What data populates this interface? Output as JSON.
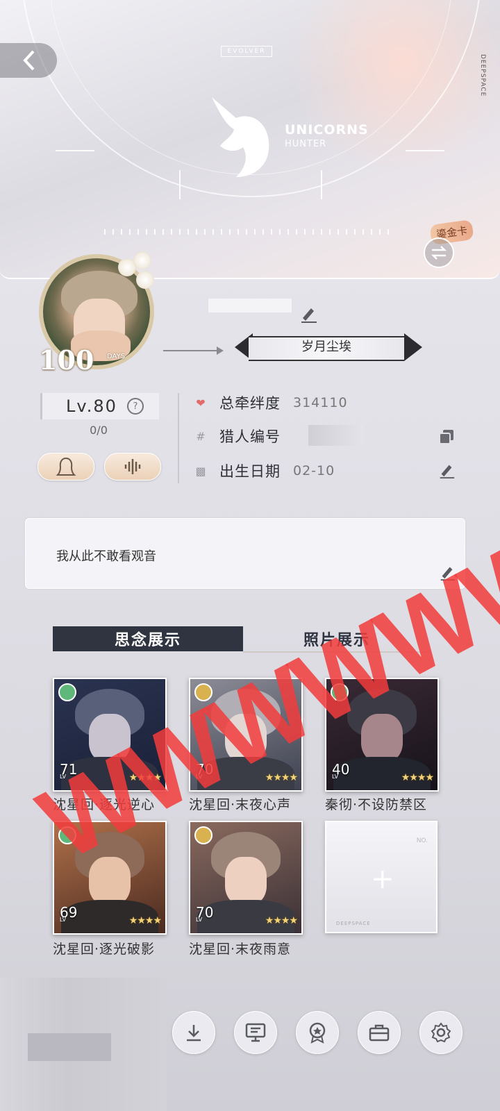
{
  "banner": {
    "evolver_label": "EVOLVER",
    "deepspace_label": "DEEPSPACE",
    "logo_line1": "UNICORNS",
    "logo_line2": "HUNTER",
    "card_badge": "鎏金卡"
  },
  "avatar": {
    "days_number": "100",
    "days_label": "DAYS"
  },
  "title_badge": "岁月尘埃",
  "level": {
    "label": "Lv.80",
    "help": "?",
    "exp": "0/0"
  },
  "info": {
    "bond_label": "总牵绊度",
    "bond_value": "314110",
    "hunter_id_label": "猎人编号",
    "birthday_label": "出生日期",
    "birthday_value": "02-10"
  },
  "signature": "我从此不敢看观音",
  "tabs": {
    "memory": "思念展示",
    "photo": "照片展示"
  },
  "memories": [
    {
      "name": "沈星回·逐光逆心",
      "level": "71",
      "badge_color": "#5fb87a"
    },
    {
      "name": "沈星回·末夜心声",
      "level": "70",
      "badge_color": "#d9b24f"
    },
    {
      "name": "秦彻·不设防禁区",
      "level": "40",
      "badge_color": "#5fb87a"
    },
    {
      "name": "沈星回·逐光破影",
      "level": "69",
      "badge_color": "#5fb87a"
    },
    {
      "name": "沈星回·末夜雨意",
      "level": "70",
      "badge_color": "#d9b24f"
    }
  ],
  "memory_lv_tag": "LV",
  "memory_stars": "★★★★",
  "add_slot": {
    "plus": "+",
    "no_label": "NO.",
    "brand": "DEEPSPACE"
  },
  "watermark": "WWWWWW",
  "dock": [
    "download-icon",
    "notice-icon",
    "badge-icon",
    "bag-icon",
    "gear-icon"
  ],
  "colors": {
    "tab_active_bg": "#2f3440",
    "heart": "#e26a6a",
    "watermark": "#f23c3c"
  }
}
